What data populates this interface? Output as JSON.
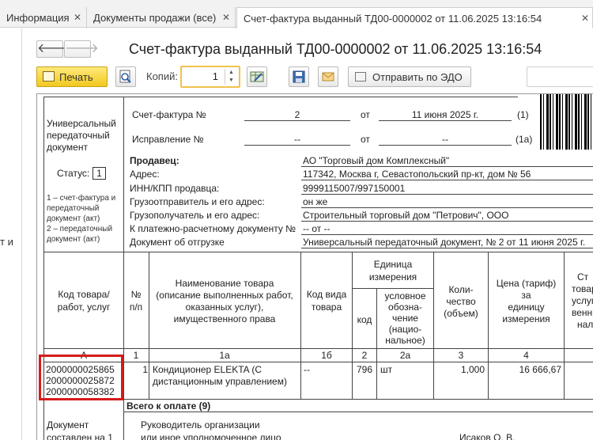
{
  "tabs": [
    {
      "label": "Информация",
      "close": "✕",
      "active": false
    },
    {
      "label": "Документы продажи (все)",
      "close": "✕",
      "active": false
    },
    {
      "label": "Счет-фактура выданный ТД00-0000002 от 11.06.2025 13:16:54",
      "close": "✕",
      "active": true
    }
  ],
  "left_pane_fragment": "т и",
  "nav": {
    "back_icon": "arrow-left-icon",
    "forward_icon": "arrow-right-icon",
    "back": "🡐",
    "forward": "🡒"
  },
  "title": "Счет-фактура выданный ТД00-0000002 от 11.06.2025 13:16:54",
  "toolbar": {
    "print_label": "Печать",
    "copies_label": "Копий:",
    "copies_value": "1",
    "send_edo_label": "Отправить по ЭДО"
  },
  "document": {
    "upd_label": [
      "Универсальный",
      "передаточный",
      "документ"
    ],
    "status_label": "Статус:",
    "status_value": "1",
    "status_notes": [
      "1 – счет-фактура и",
      "передаточный",
      "документ (акт)",
      "2 – передаточный",
      "документ (акт)"
    ],
    "invoice_no_label": "Счет-фактура №",
    "invoice_no": "2",
    "from_label": "от",
    "invoice_date": "11 июня 2025 г.",
    "line_1": "(1)",
    "correction_label": "Исправление №",
    "correction_no": "--",
    "correction_date": "--",
    "line_1a": "(1а)",
    "seller_label": "Продавец:",
    "seller": "АО \"Торговый дом Комплексный\"",
    "address_label": "Адрес:",
    "address": "117342, Москва г, Севастопольский пр-кт, дом № 56",
    "inn_label": "ИНН/КПП продавца:",
    "inn": "9999115007/997150001",
    "shipper_label": "Грузоотправитель и его адрес:",
    "shipper": "он же",
    "consignee_label": "Грузополучатель и его адрес:",
    "consignee": "Строительный торговый дом \"Петрович\", ООО",
    "payment_doc_label": "К платежно-расчетному документу №",
    "payment_doc": "-- от --",
    "shipment_doc_label": "Документ об отгрузке",
    "shipment_doc": "Универсальный передаточный документ, № 2 от 11 июня 2025 г.",
    "table": {
      "col_code": [
        "Код товара/",
        "работ, услуг"
      ],
      "col_num": [
        "№",
        "п/п"
      ],
      "col_name": [
        "Наименование товара",
        "(описание выполненных работ,",
        "оказанных услуг),",
        "имущественного права"
      ],
      "col_kind": [
        "Код вида",
        "товара"
      ],
      "col_unit": [
        "Единица",
        "измерения"
      ],
      "col_unit_code": "код",
      "col_unit_name": [
        "условное",
        "обозна-",
        "чение",
        "(нацио-",
        "нальное)"
      ],
      "col_qty": [
        "Коли-",
        "чество",
        "(объем)"
      ],
      "col_price": [
        "Цена (тариф)",
        "за",
        "единицу",
        "измерения"
      ],
      "col_cost": [
        "Ст",
        "товар",
        "услуг",
        "венны",
        "нало"
      ],
      "idx": [
        "А",
        "1",
        "1а",
        "1б",
        "2",
        "2а",
        "3",
        "4"
      ],
      "row": {
        "codes": [
          "2000000025865",
          "2000000025872",
          "2000000058382"
        ],
        "num": "1",
        "name": [
          "Кондиционер ELEKTA (С",
          "дистанционным управлением)"
        ],
        "kind": "--",
        "unit_code": "796",
        "unit_name": "шт",
        "qty": "1,000",
        "price": "16 666,67"
      },
      "total_label": "Всего к оплате (9)"
    },
    "footer_left": [
      "Документ",
      "составлен на 1"
    ],
    "footer_mid": [
      "Руководитель организации",
      "или иное уполномоченное лицо"
    ],
    "footer_name": "Исаков О. В."
  }
}
